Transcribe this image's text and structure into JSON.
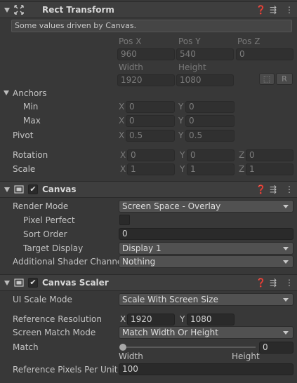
{
  "rect_transform": {
    "title": "Rect Transform",
    "info": "Some values driven by Canvas.",
    "pos_x_label": "Pos X",
    "pos_y_label": "Pos Y",
    "pos_z_label": "Pos Z",
    "pos_x": "960",
    "pos_y": "540",
    "pos_z": "0",
    "width_label": "Width",
    "height_label": "Height",
    "width": "1920",
    "height": "1080",
    "raw_button": "R",
    "anchors_label": "Anchors",
    "min_label": "Min",
    "max_label": "Max",
    "min_x": "0",
    "min_y": "0",
    "max_x": "0",
    "max_y": "0",
    "pivot_label": "Pivot",
    "pivot_x": "0.5",
    "pivot_y": "0.5",
    "rotation_label": "Rotation",
    "rot_x": "0",
    "rot_y": "0",
    "rot_z": "0",
    "scale_label": "Scale",
    "scale_x": "1",
    "scale_y": "1",
    "scale_z": "1",
    "axis_x": "X",
    "axis_y": "Y",
    "axis_z": "Z"
  },
  "canvas": {
    "title": "Canvas",
    "render_mode_label": "Render Mode",
    "render_mode": "Screen Space - Overlay",
    "pixel_perfect_label": "Pixel Perfect",
    "sort_order_label": "Sort Order",
    "sort_order": "0",
    "target_display_label": "Target Display",
    "target_display": "Display 1",
    "shader_channel_label": "Additional Shader Channel",
    "shader_channel": "Nothing"
  },
  "canvas_scaler": {
    "title": "Canvas Scaler",
    "ui_scale_mode_label": "UI Scale Mode",
    "ui_scale_mode": "Scale With Screen Size",
    "ref_res_label": "Reference Resolution",
    "ref_res_x": "1920",
    "ref_res_y": "1080",
    "axis_x": "X",
    "axis_y": "Y",
    "match_mode_label": "Screen Match Mode",
    "match_mode": "Match Width Or Height",
    "match_label": "Match",
    "match_value": "0",
    "match_fraction": 0,
    "width_word": "Width",
    "height_word": "Height",
    "ppu_label": "Reference Pixels Per Unit",
    "ppu": "100"
  },
  "icons": [
    "rect-transform-icon",
    "help-icon",
    "preset-icon",
    "more-icon",
    "canvas-icon",
    "canvas-scaler-icon",
    "blueprint-icon",
    "checkmark-icon",
    "dropdown-arrow-icon",
    "foldout-arrow-icon"
  ]
}
